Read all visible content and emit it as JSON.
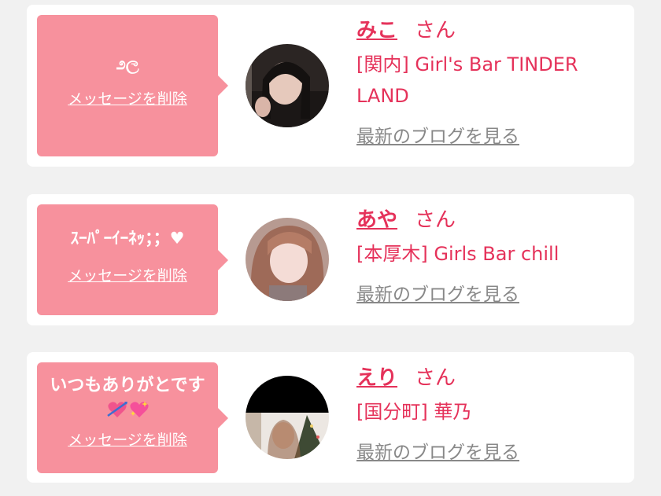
{
  "cards": [
    {
      "message": "೨ල",
      "delete_label": "メッセージを削除",
      "name": "みこ",
      "honorific": "さん",
      "shop": "[関内] Girl's Bar TINDER LAND",
      "blog_label": "最新のブログを見る"
    },
    {
      "message": "ｽｰﾊﾟｰｲｰﾈｯ；；♥",
      "delete_label": "メッセージを削除",
      "name": "あや",
      "honorific": "さん",
      "shop": "[本厚木] Girls Bar chill",
      "blog_label": "最新のブログを見る"
    },
    {
      "message": "いつもありがとです",
      "emoji_icons": [
        "heart-with-arrow-icon",
        "sparkling-heart-icon"
      ],
      "delete_label": "メッセージを削除",
      "name": "えり",
      "honorific": "さん",
      "shop": "[国分町] 華乃",
      "blog_label": "最新のブログを見る"
    }
  ],
  "colors": {
    "bubble": "#f7919d",
    "accent": "#e5325a",
    "link_gray": "#888888",
    "background": "#f1f1f1"
  }
}
